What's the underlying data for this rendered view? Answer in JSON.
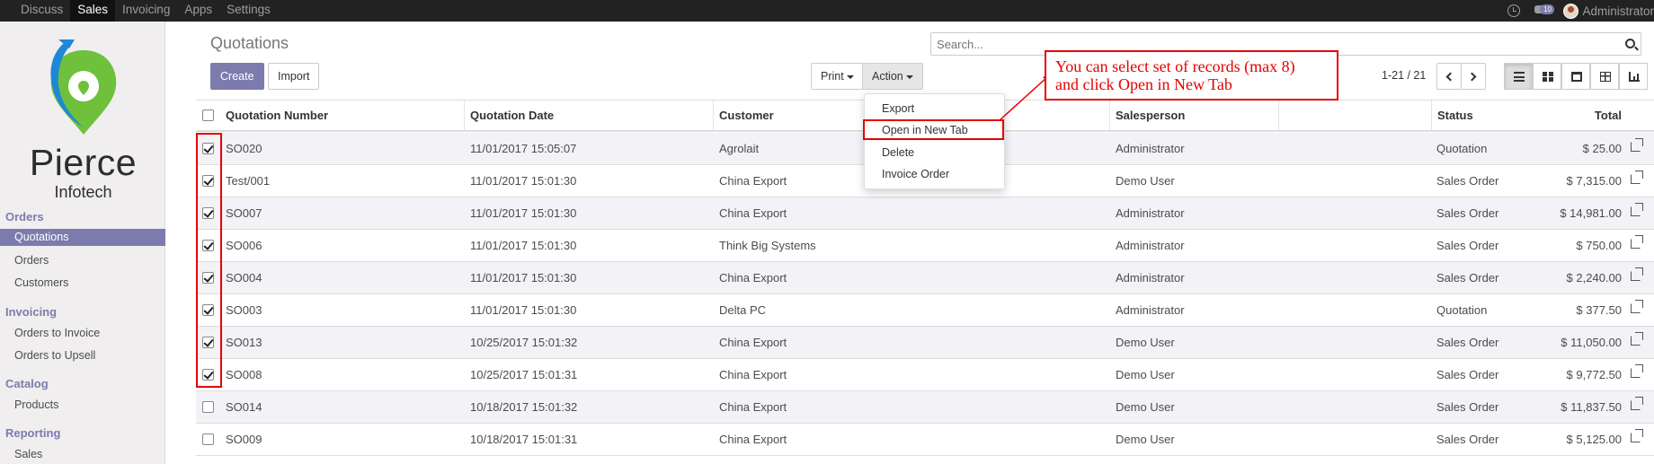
{
  "navbar": {
    "menu": [
      "Discuss",
      "Sales",
      "Invoicing",
      "Apps",
      "Settings"
    ],
    "active": "Sales",
    "chat_badge": "10",
    "user": "Administrator"
  },
  "sidebar": {
    "logo": {
      "brand": "Pierce",
      "sub": "Infotech"
    },
    "sections": [
      {
        "title": "Orders",
        "items": [
          "Quotations",
          "Orders",
          "Customers"
        ]
      },
      {
        "title": "Invoicing",
        "items": [
          "Orders to Invoice",
          "Orders to Upsell"
        ]
      },
      {
        "title": "Catalog",
        "items": [
          "Products"
        ]
      },
      {
        "title": "Reporting",
        "items": [
          "Sales"
        ]
      }
    ],
    "active_item": "Quotations"
  },
  "header": {
    "title": "Quotations",
    "search_placeholder": "Search...",
    "create_label": "Create",
    "import_label": "Import",
    "print_label": "Print",
    "action_label": "Action",
    "pager": "1-21 / 21"
  },
  "action_menu": [
    "Export",
    "Open in New Tab",
    "Delete",
    "Invoice Order"
  ],
  "table": {
    "columns": [
      "Quotation Number",
      "Quotation Date",
      "Customer",
      "Salesperson",
      "Total",
      "Status"
    ],
    "rows": [
      {
        "number": "SO020",
        "date": "11/01/2017 15:05:07",
        "customer": "Agrolait",
        "salesperson": "Administrator",
        "total": "$ 25.00",
        "status": "Quotation",
        "checked": true
      },
      {
        "number": "Test/001",
        "date": "11/01/2017 15:01:30",
        "customer": "China Export",
        "salesperson": "Demo User",
        "total": "$ 7,315.00",
        "status": "Sales Order",
        "checked": true
      },
      {
        "number": "SO007",
        "date": "11/01/2017 15:01:30",
        "customer": "China Export",
        "salesperson": "Administrator",
        "total": "$ 14,981.00",
        "status": "Sales Order",
        "checked": true
      },
      {
        "number": "SO006",
        "date": "11/01/2017 15:01:30",
        "customer": "Think Big Systems",
        "salesperson": "Administrator",
        "total": "$ 750.00",
        "status": "Sales Order",
        "checked": true
      },
      {
        "number": "SO004",
        "date": "11/01/2017 15:01:30",
        "customer": "China Export",
        "salesperson": "Administrator",
        "total": "$ 2,240.00",
        "status": "Sales Order",
        "checked": true
      },
      {
        "number": "SO003",
        "date": "11/01/2017 15:01:30",
        "customer": "Delta PC",
        "salesperson": "Administrator",
        "total": "$ 377.50",
        "status": "Quotation",
        "checked": true
      },
      {
        "number": "SO013",
        "date": "10/25/2017 15:01:32",
        "customer": "China Export",
        "salesperson": "Demo User",
        "total": "$ 11,050.00",
        "status": "Sales Order",
        "checked": true
      },
      {
        "number": "SO008",
        "date": "10/25/2017 15:01:31",
        "customer": "China Export",
        "salesperson": "Demo User",
        "total": "$ 9,772.50",
        "status": "Sales Order",
        "checked": true
      },
      {
        "number": "SO014",
        "date": "10/18/2017 15:01:32",
        "customer": "China Export",
        "salesperson": "Demo User",
        "total": "$ 11,837.50",
        "status": "Sales Order",
        "checked": false
      },
      {
        "number": "SO009",
        "date": "10/18/2017 15:01:31",
        "customer": "China Export",
        "salesperson": "Demo User",
        "total": "$ 5,125.00",
        "status": "Sales Order",
        "checked": false
      }
    ]
  },
  "annotation": {
    "line1": "You can select set of records (max 8)",
    "line2": "and click Open in New Tab"
  },
  "colors": {
    "accent": "#7c7bad",
    "annotation": "#e60000",
    "navbar": "#222222"
  }
}
